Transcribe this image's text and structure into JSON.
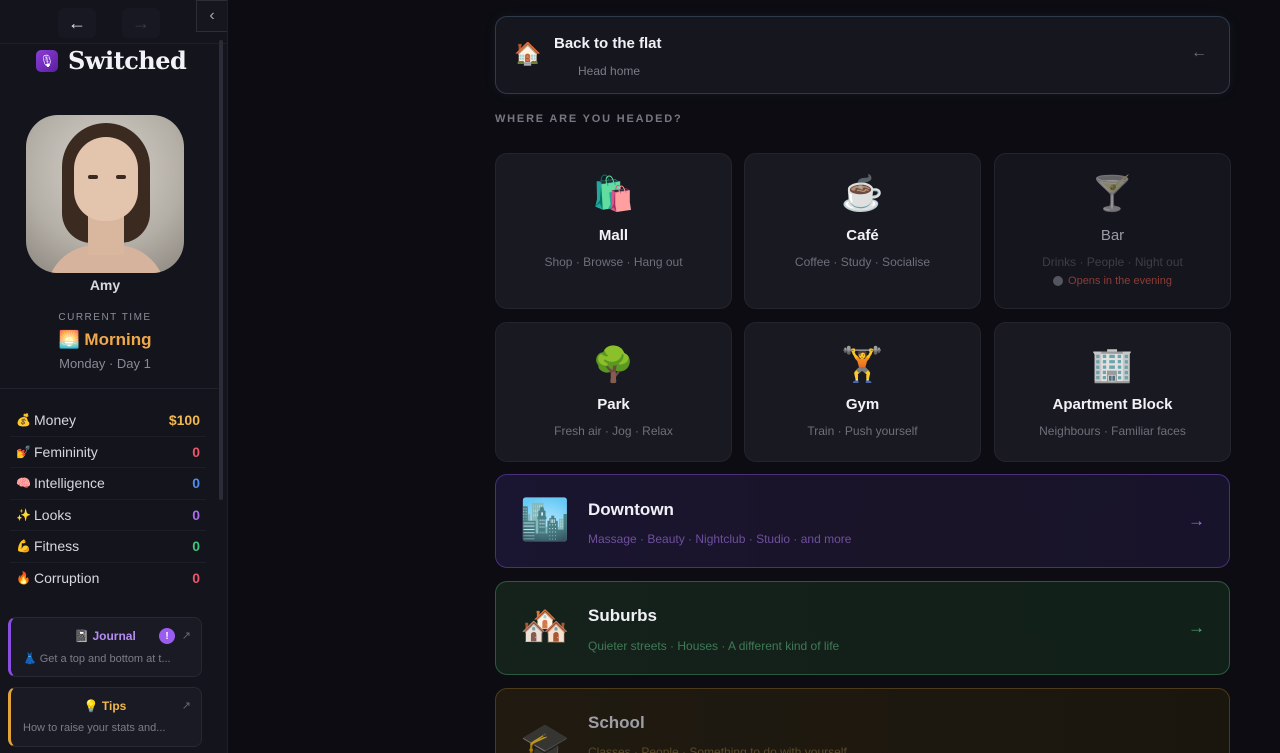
{
  "sidebar": {
    "nav": {
      "back_icon": "←",
      "forward_icon": "→",
      "collapse_icon": "‹"
    },
    "brand": {
      "icon": "🎙",
      "title": "Switched"
    },
    "character": {
      "name": "Amy"
    },
    "time": {
      "label": "CURRENT TIME",
      "value": "🌅 Morning",
      "sub": "Monday · Day 1"
    },
    "stats": [
      {
        "emoji": "💰",
        "label": "Money",
        "value": "$100",
        "color": "#f0b84e"
      },
      {
        "emoji": "💅",
        "label": "Femininity",
        "value": "0",
        "color": "#e8566a"
      },
      {
        "emoji": "🧠",
        "label": "Intelligence",
        "value": "0",
        "color": "#4f8ef0"
      },
      {
        "emoji": "✨",
        "label": "Looks",
        "value": "0",
        "color": "#a86cf0"
      },
      {
        "emoji": "💪",
        "label": "Fitness",
        "value": "0",
        "color": "#3fc47a"
      },
      {
        "emoji": "🔥",
        "label": "Corruption",
        "value": "0",
        "color": "#e8566a"
      }
    ],
    "journal": {
      "title": "📓 Journal",
      "badge": "!",
      "sub": "👗 Get a top and bottom at t...",
      "ext_icon": "↗"
    },
    "tips": {
      "title": "💡 Tips",
      "sub": "How to raise your stats and...",
      "ext_icon": "↗"
    }
  },
  "main": {
    "back": {
      "icon": "🏠",
      "title": "Back to the flat",
      "sub": "Head home",
      "arrow": "←"
    },
    "section_label": "WHERE ARE YOU HEADED?",
    "tiles": [
      {
        "icon": "🛍️",
        "title": "Mall",
        "sub": "Shop · Browse · Hang out"
      },
      {
        "icon": "☕",
        "title": "Café",
        "sub": "Coffee · Study · Socialise"
      },
      {
        "icon": "🍸",
        "title": "Bar",
        "sub": "Drinks · People · Night out",
        "note": "Opens in the evening"
      },
      {
        "icon": "🌳",
        "title": "Park",
        "sub": "Fresh air · Jog · Relax"
      },
      {
        "icon": "🏋️",
        "title": "Gym",
        "sub": "Train · Push yourself"
      },
      {
        "icon": "🏢",
        "title": "Apartment Block",
        "sub": "Neighbours · Familiar faces"
      }
    ],
    "downtown": {
      "icon": "🏙️",
      "title": "Downtown",
      "sub": "Massage · Beauty · Nightclub · Studio · and more",
      "arrow": "→"
    },
    "suburbs": {
      "icon": "🏘️",
      "title": "Suburbs",
      "sub": "Quieter streets · Houses · A different kind of life",
      "arrow": "→"
    },
    "school": {
      "icon": "🎓",
      "title": "School",
      "sub": "Classes · People · Something to do with yourself"
    }
  }
}
